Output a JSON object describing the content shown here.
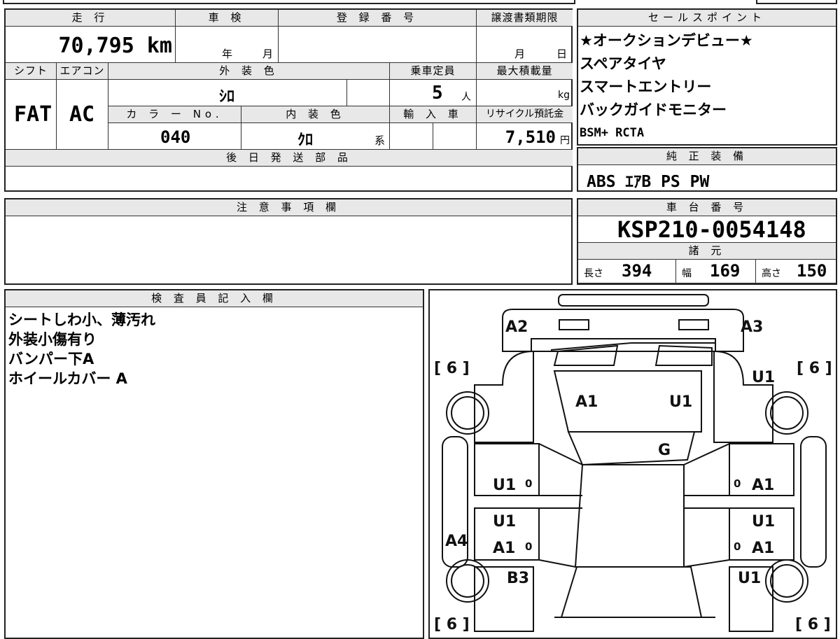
{
  "main_table": {
    "mileage_header": "走 行",
    "mileage_value": "70,795 km",
    "inspection_header": "車 検",
    "inspection_year": "年",
    "inspection_month": "月",
    "registration_header": "登 録 番 号",
    "transfer_header": "譲渡書類期限",
    "transfer_month": "月",
    "transfer_day": "日",
    "shift_header": "シフト",
    "shift_value": "FAT",
    "ac_header": "エアコン",
    "ac_value": "AC",
    "exterior_color_header": "外 装 色",
    "exterior_color_value": "ｼﾛ",
    "capacity_header": "乗車定員",
    "capacity_value": "5",
    "capacity_unit": "人",
    "max_load_header": "最大積載量",
    "max_load_unit": "kg",
    "color_no_header": "カ ラ ー No.",
    "color_no_value": "040",
    "interior_color_header": "内 装 色",
    "interior_color_value": "ｸﾛ",
    "interior_color_suffix": "系",
    "import_header": "輸 入 車",
    "recycle_header": "リサイクル預託金",
    "recycle_value": "7,510",
    "recycle_unit": "円",
    "later_parts_header": "後 日 発 送 部 品"
  },
  "sales_points": {
    "header": "セールスポイント",
    "items": [
      "★オークションデビュー★",
      "スペアタイヤ",
      "スマートエントリー",
      "バックガイドモニター",
      "BSM+ RCTA"
    ]
  },
  "equipment": {
    "header": "純 正 装 備",
    "value": "ABS ｴｱB PS PW"
  },
  "notes": {
    "header": "注 意 事 項 欄"
  },
  "chassis": {
    "header": "車 台 番 号",
    "value": "KSP210-0054148",
    "specs_header": "諸 元",
    "length_label": "長さ",
    "length_value": "394",
    "width_label": "幅",
    "width_value": "169",
    "height_label": "高さ",
    "height_value": "150"
  },
  "inspector": {
    "header": "検 査 員 記 入 欄",
    "lines": [
      "シートしわ小、薄汚れ",
      "外装小傷有り",
      "バンパー下A",
      "ホイールカバー A"
    ]
  },
  "diagram": {
    "tire_label": "[ 6 ]",
    "marks": {
      "a2": "A2",
      "a3": "A3",
      "a1_hood": "A1",
      "u1_hood": "U1",
      "g_glass": "G",
      "u1_right_front_tire": "U1",
      "u1_lf": "U1",
      "zero_lf": "0",
      "zero_rf": "0",
      "a1_rf": "A1",
      "u1_lr_top": "U1",
      "a1_lr": "A1",
      "zero_lr": "0",
      "u1_rr_top": "U1",
      "zero_rr": "0",
      "a1_rr": "A1",
      "a4": "A4",
      "b3": "B3",
      "u1_rear_tire": "U1"
    }
  }
}
